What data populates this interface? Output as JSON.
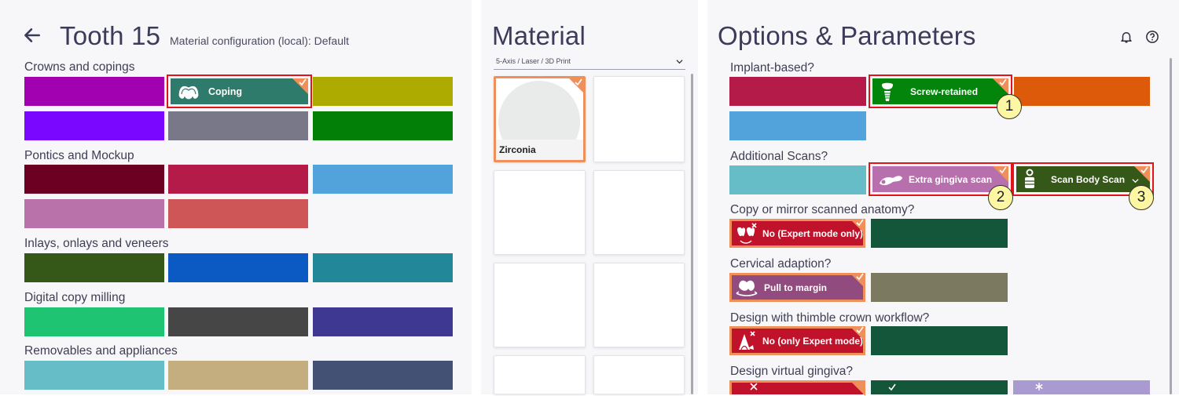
{
  "left": {
    "title": "Tooth 15",
    "subtitle": "Material configuration (local):  Default",
    "sections": {
      "crowns": "Crowns and copings",
      "pontics": "Pontics and Mockup",
      "inlays": "Inlays, onlays and veneers",
      "digital_copy": "Digital copy milling",
      "removables": "Removables and appliances"
    },
    "selected_tile": "Coping"
  },
  "middle": {
    "title": "Material",
    "dropdown_value": "5-Axis / Laser / 3D Print",
    "selected_material": "Zirconia"
  },
  "right": {
    "title": "Options & Parameters",
    "questions": {
      "implant": "Implant-based?",
      "scans": "Additional Scans?",
      "copy": "Copy or mirror scanned anatomy?",
      "cervical": "Cervical adaption?",
      "thimble": "Design with thimble crown workflow?",
      "gingiva": "Design virtual gingiva?"
    },
    "options": {
      "screw": "Screw-retained",
      "extra_gingiva": "Extra gingiva scan",
      "scan_body": "Scan Body Scan",
      "no_expert": "No (Expert mode only)",
      "pull_margin": "Pull to margin",
      "no_only_expert": "No (only Expert mode)"
    },
    "badges": [
      "1",
      "2",
      "3"
    ]
  },
  "icons": {
    "back": "arrow-left-icon",
    "bell": "bell-icon",
    "help": "help-circle-icon"
  }
}
